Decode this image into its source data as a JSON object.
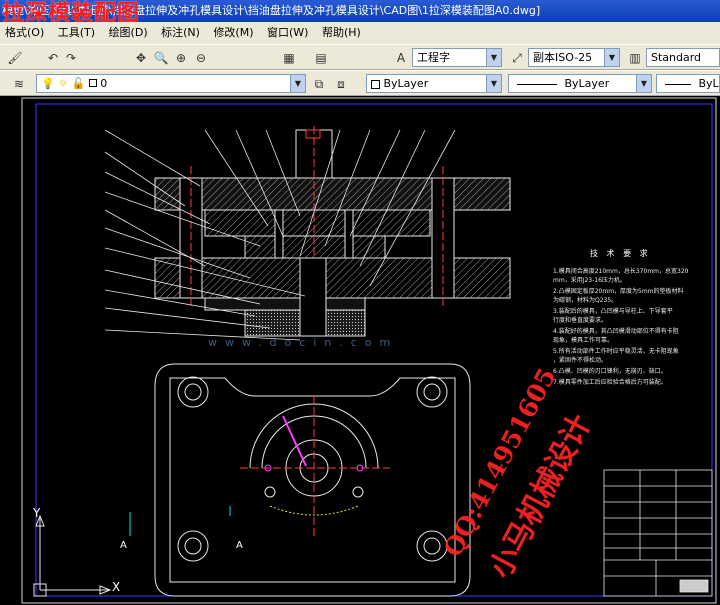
{
  "window": {
    "title_path": "模理\\冲压模具\\冲压模\\挡油盘拉伸及冲孔模具设计\\挡油盘拉伸及冲孔模具设计\\CAD图\\1拉深模装配图A0.dwg]",
    "overlay_title": "拉深模装配图"
  },
  "menu": {
    "items": [
      "格式(O)",
      "工具(T)",
      "绘图(D)",
      "标注(N)",
      "修改(M)",
      "窗口(W)",
      "帮助(H)"
    ]
  },
  "toolbar": {
    "text_style": "工程字",
    "dim_style": "副本ISO-25",
    "table_style": "Standard"
  },
  "layers": {
    "current_layer": "0",
    "color": "ByLayer",
    "linetype": "ByLayer",
    "lineweight": "ByLay"
  },
  "drawing": {
    "tech_title": "技 术 要 求",
    "tech_lines": [
      "1.模具闭合高度210mm，总长370mm，总宽320",
      "mm，采用J23-16压力机。",
      "2.凸模固定板厚20mm，厚度为5mm的垫板材料",
      "为碳钢，材料为Q235。",
      "3.装配后的模具，凸凹模与导柱上、下导套平",
      "行度和垂直度要求。",
      "4.装配好的模具，其凸凹模滑动部位不得有卡阻",
      "现象，模具工作可靠。",
      "5.所有活动部件工作时应平稳灵活，无卡阻现象",
      "，紧固件不得松动。",
      "6.凸模、凹模的刃口锋利，无崩刃、缺口。",
      "7.模具零件加工后应检验合格后方可装配。"
    ],
    "watermark_doc": "www.docin.com",
    "watermark_qq": "QQ:414951605",
    "watermark_cn": "小马机械设计",
    "section_labels": [
      "A",
      "A"
    ],
    "axis": {
      "y": "Y",
      "x": "X"
    }
  }
}
